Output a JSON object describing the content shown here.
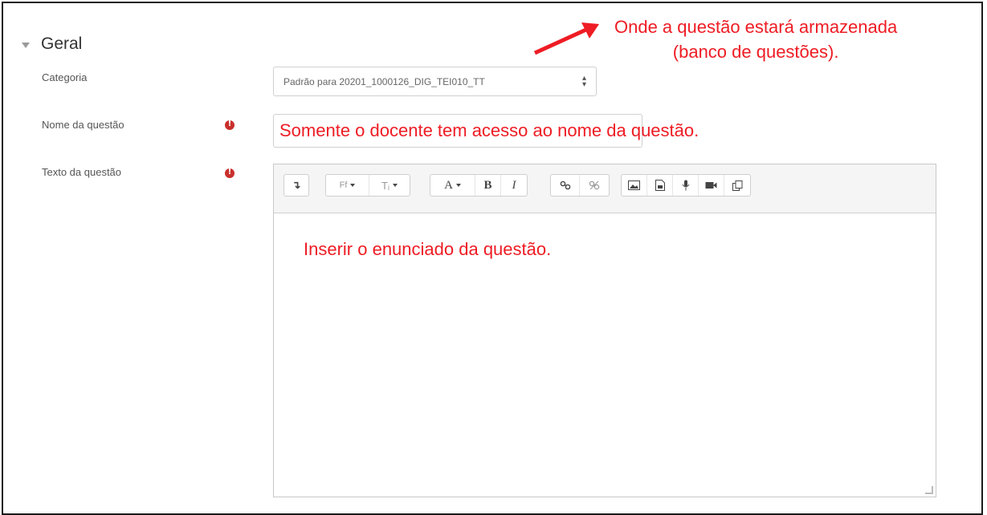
{
  "section": {
    "title": "Geral"
  },
  "fields": {
    "category": {
      "label": "Categoria",
      "value": "Padrão para 20201_1000126_DIG_TEI010_TT"
    },
    "question_name": {
      "label": "Nome da questão"
    },
    "question_text": {
      "label": "Texto da questão"
    }
  },
  "toolbar": {
    "groups": [
      [
        "collapse-icon"
      ],
      [
        "font-family-icon",
        "font-size-icon"
      ],
      [
        "font-color-icon",
        "bold-icon",
        "italic-icon"
      ],
      [
        "link-icon",
        "unlink-icon"
      ],
      [
        "image-icon",
        "media-icon",
        "record-audio-icon",
        "record-video-icon",
        "manage-files-icon"
      ]
    ],
    "labels": {
      "collapse": "↴",
      "font_family": "Ff",
      "font_size": "Tᵢ",
      "font_color": "A",
      "bold": "B",
      "italic": "I"
    }
  },
  "annotations": {
    "storage_line1": "Onde a questão estará armazenada",
    "storage_line2": "(banco de questões).",
    "name_note": "Somente o docente tem acesso ao nome da questão.",
    "text_note": "Inserir o enunciado da questão."
  },
  "colors": {
    "annotation": "#ee1c24",
    "required": "#c9302c"
  }
}
